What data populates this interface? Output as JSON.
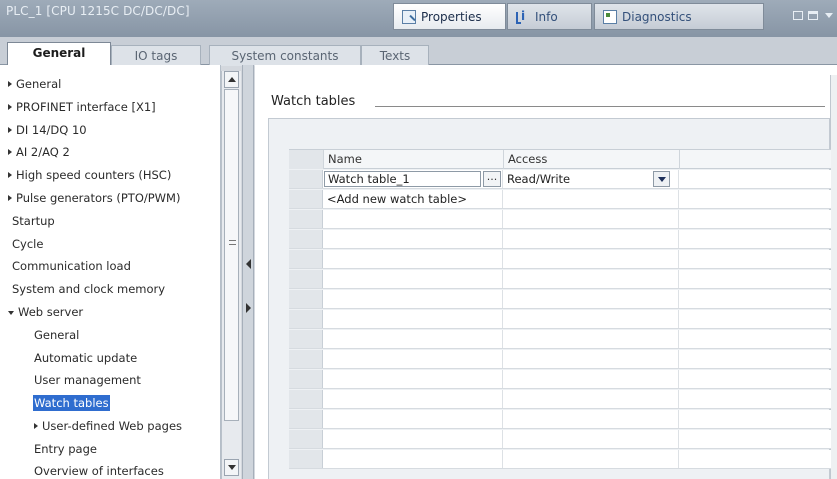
{
  "window": {
    "title": "PLC_1 [CPU 1215C DC/DC/DC]",
    "tabs": [
      {
        "label": "Properties",
        "icon": "properties-icon",
        "active": true
      },
      {
        "label": "Info",
        "icon": "info-icon",
        "active": false
      },
      {
        "label": "Diagnostics",
        "icon": "diagnostics-icon",
        "active": false
      }
    ]
  },
  "subtabs": [
    {
      "label": "General",
      "active": true
    },
    {
      "label": "IO tags",
      "active": false
    },
    {
      "label": "System constants",
      "active": false
    },
    {
      "label": "Texts",
      "active": false
    }
  ],
  "nav": {
    "items": [
      {
        "label": "General",
        "arrow": "right",
        "level": 0
      },
      {
        "label": "PROFINET interface [X1]",
        "arrow": "right",
        "level": 0
      },
      {
        "label": "DI 14/DQ 10",
        "arrow": "right",
        "level": 0
      },
      {
        "label": "AI 2/AQ 2",
        "arrow": "right",
        "level": 0
      },
      {
        "label": "High speed counters (HSC)",
        "arrow": "right",
        "level": 0
      },
      {
        "label": "Pulse generators (PTO/PWM)",
        "arrow": "right",
        "level": 0
      },
      {
        "label": "Startup",
        "arrow": "none",
        "level": 0
      },
      {
        "label": "Cycle",
        "arrow": "none",
        "level": 0
      },
      {
        "label": "Communication load",
        "arrow": "none",
        "level": 0
      },
      {
        "label": "System and clock memory",
        "arrow": "none",
        "level": 0
      },
      {
        "label": "Web server",
        "arrow": "down",
        "level": 0
      },
      {
        "label": "General",
        "arrow": "none",
        "level": 1
      },
      {
        "label": "Automatic update",
        "arrow": "none",
        "level": 1
      },
      {
        "label": "User management",
        "arrow": "none",
        "level": 1
      },
      {
        "label": "Watch tables",
        "arrow": "none",
        "level": 1,
        "selected": true
      },
      {
        "label": "User-defined Web pages",
        "arrow": "right",
        "level": 1
      },
      {
        "label": "Entry page",
        "arrow": "none",
        "level": 1
      },
      {
        "label": "Overview of interfaces",
        "arrow": "none",
        "level": 1
      }
    ]
  },
  "main": {
    "section_title": "Watch tables",
    "table": {
      "columns": [
        "Name",
        "Access"
      ],
      "rows": [
        {
          "name": "Watch table_1",
          "access": "Read/Write"
        }
      ],
      "add_new_label": "<Add new watch table>",
      "browse_label": "..."
    }
  },
  "colors": {
    "titlebar": "#8f9cad",
    "selection": "#2f6dcf",
    "grid_bg": "#eef1f4"
  }
}
